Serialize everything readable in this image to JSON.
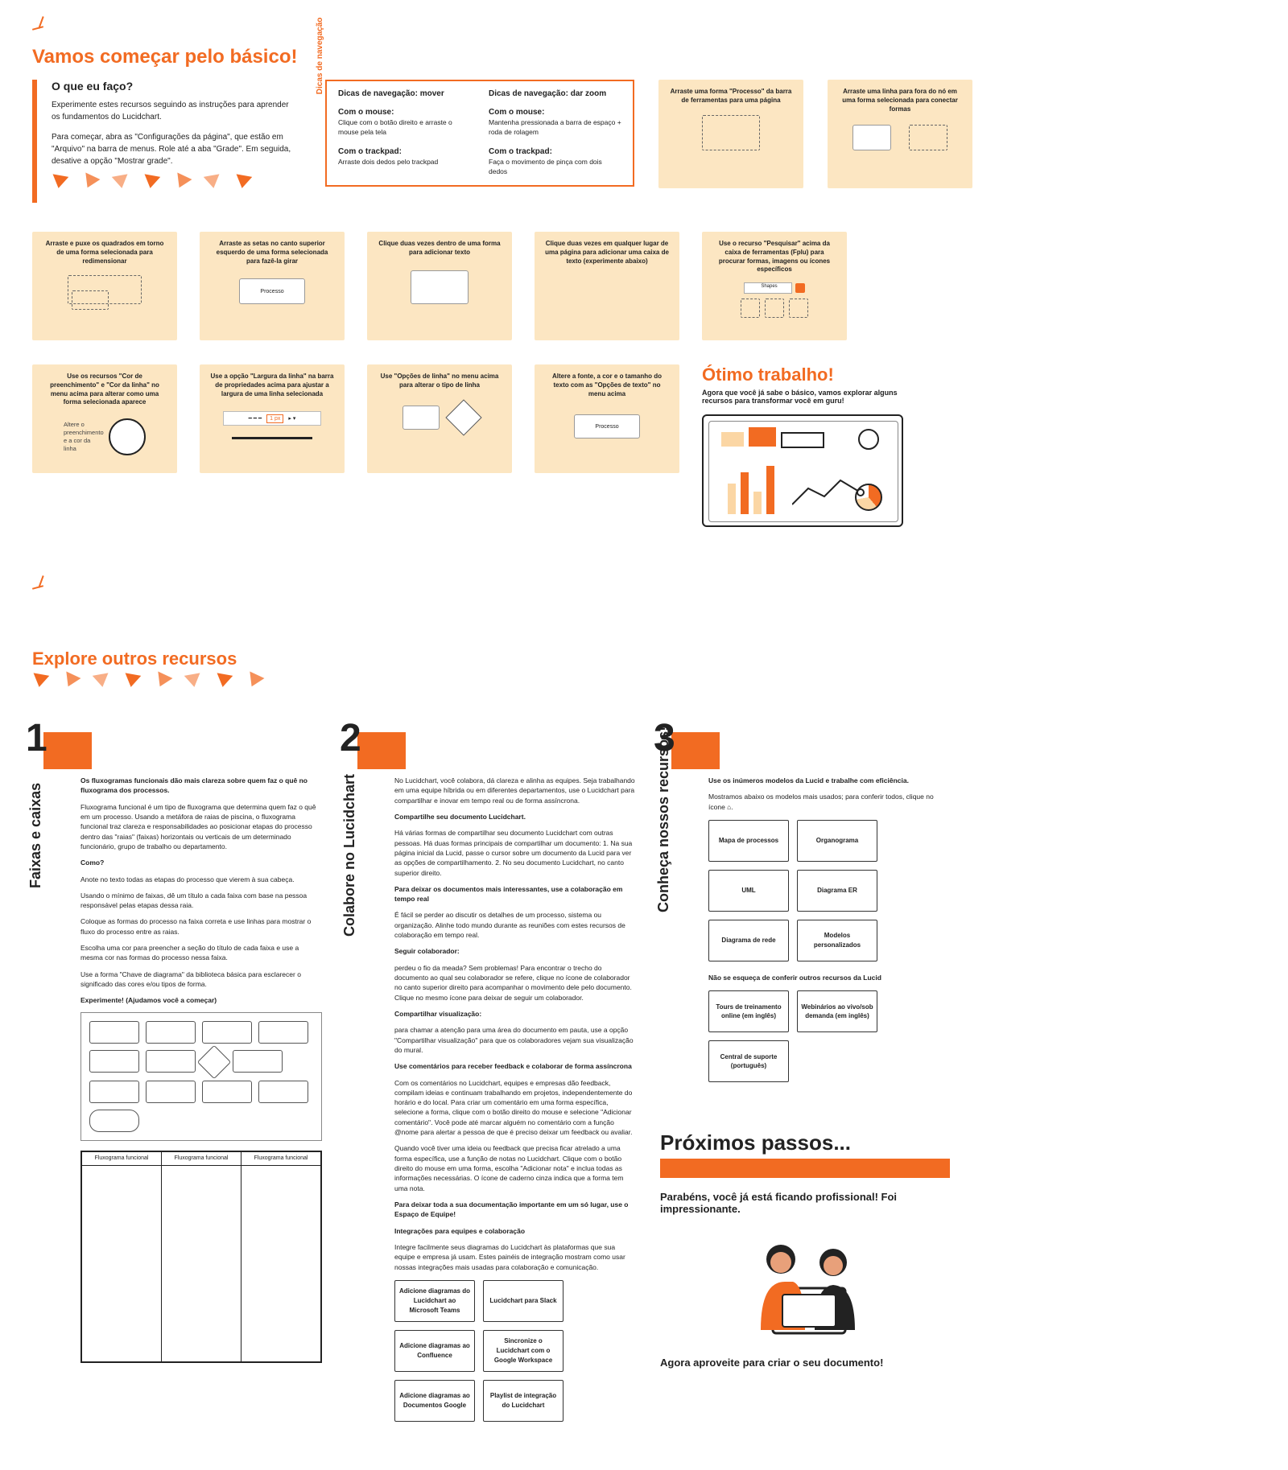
{
  "header": {
    "title": "Vamos começar pelo básico!",
    "q": "O que eu faço?",
    "p1": "Experimente estes recursos seguindo as instruções para aprender os fundamentos do Lucidchart.",
    "p2": "Para começar, abra as \"Configurações da página\", que estão em \"Arquivo\" na barra de menus. Role até a aba \"Grade\". Em seguida, desative a opção \"Mostrar grade\"."
  },
  "nav": {
    "label": "Dicas de navegação",
    "col1": {
      "title": "Dicas de navegação: mover",
      "l1": "Com o mouse:",
      "l1b": "Clique com o botão direito e arraste o mouse pela tela",
      "l2": "Com o trackpad:",
      "l2b": "Arraste dois dedos pelo trackpad"
    },
    "col2": {
      "title": "Dicas de navegação: dar zoom",
      "l1": "Com o mouse:",
      "l1b": "Mantenha pressionada a barra de espaço + roda de rolagem",
      "l2": "Com o trackpad:",
      "l2b": "Faça o movimento de pinça com dois dedos"
    }
  },
  "tips": {
    "t1": "Arraste uma forma \"Processo\" da barra de ferramentas para uma página",
    "t2": "Arraste uma linha para fora do nó em uma forma selecionada para conectar formas",
    "t3": "Arraste e puxe os quadrados em torno de uma forma selecionada para redimensionar",
    "t4": "Arraste as setas no canto superior esquerdo de uma forma selecionada para fazê-la girar",
    "t4b": "Processo",
    "t5": "Clique duas vezes dentro de uma forma para adicionar texto",
    "t6": "Clique duas vezes em qualquer lugar de uma página para adicionar uma caixa de texto (experimente abaixo)",
    "t7": "Use o recurso \"Pesquisar\" acima da caixa de ferramentas (Fplu) para procurar formas, imagens ou ícones específicos",
    "t7b": "Shapes",
    "t8": "Use os recursos \"Cor de preenchimento\" e \"Cor da linha\" no menu acima para alterar como uma forma selecionada aparece",
    "t9": "Use a opção \"Largura da linha\" na barra de propriedades acima para ajustar a largura de uma linha selecionada",
    "t10": "Use \"Opções de linha\" no menu acima para alterar o tipo de linha",
    "t11": "Altere a fonte, a cor e o tamanho do texto com as \"Opções de texto\" no menu acima",
    "t11b": "Processo"
  },
  "goodjob": {
    "title": "Ótimo trabalho!",
    "sub": "Agora que você já sabe o básico, vamos explorar alguns recursos para transformar você em guru!"
  },
  "explore": {
    "title": "Explore outros recursos"
  },
  "col1": {
    "vtitle": "Faixas e caixas",
    "lead": "Os fluxogramas funcionais dão mais clareza sobre quem faz o quê no fluxograma dos processos.",
    "p1": "Fluxograma funcional é um tipo de fluxograma que determina quem faz o quê em um processo. Usando a metáfora de raias de piscina, o fluxograma funcional traz clareza e responsabilidades ao posicionar etapas do processo dentro das \"raias\" (faixas) horizontais ou verticais de um determinado funcionário, grupo de trabalho ou departamento.",
    "h2": "Como?",
    "p2": "Anote no texto todas as etapas do processo que vierem à sua cabeça.",
    "p3": "Usando o mínimo de faixas, dê um título a cada faixa com base na pessoa responsável pelas etapas dessa raia.",
    "p4": "Coloque as formas do processo na faixa correta e use linhas para mostrar o fluxo do processo entre as raias.",
    "p5": "Escolha uma cor para preencher a seção do título de cada faixa e use a mesma cor nas formas do processo nessa faixa.",
    "p6": "Use a forma \"Chave de diagrama\" da biblioteca básica para esclarecer o significado das cores e/ou tipos de forma.",
    "try": "Experimente! (Ajudamos você a começar)",
    "lane": "Fluxograma funcional"
  },
  "col2": {
    "vtitle": "Colabore no Lucidchart",
    "lead": "No Lucidchart, você colabora, dá clareza e alinha as equipes. Seja trabalhando em uma equipe híbrida ou em diferentes departamentos, use o Lucidchart para compartilhar e inovar em tempo real ou de forma assíncrona.",
    "sh": "Compartilhe seu documento Lucidchart.",
    "shp": "Há várias formas de compartilhar seu documento Lucidchart com outras pessoas. Há duas formas principais de compartilhar um documento: 1. Na sua página inicial da Lucid, passe o cursor sobre um documento da Lucid para ver as opções de compartilhamento. 2. No seu documento Lucidchart, no canto superior direito.",
    "rt": "Para deixar os documentos mais interessantes, use a colaboração em tempo real",
    "rtp": "É fácil se perder ao discutir os detalhes de um processo, sistema ou organização. Alinhe todo mundo durante as reuniões com estes recursos de colaboração em tempo real.",
    "fo": "Seguir colaborador:",
    "fop": "perdeu o fio da meada? Sem problemas! Para encontrar o trecho do documento ao qual seu colaborador se refere, clique no ícone de colaborador no canto superior direito para acompanhar o movimento dele pelo documento. Clique no mesmo ícone para deixar de seguir um colaborador.",
    "sv": "Compartilhar visualização:",
    "svp": "para chamar a atenção para uma área do documento em pauta, use a opção \"Compartilhar visualização\" para que os colaboradores vejam sua visualização do mural.",
    "cm": "Use comentários para receber feedback e colaborar de forma assíncrona",
    "cmp": "Com os comentários no Lucidchart, equipes e empresas dão feedback, compilam ideias e continuam trabalhando em projetos, independentemente do horário e do local. Para criar um comentário em uma forma específica, selecione a forma, clique com o botão direito do mouse e selecione \"Adicionar comentário\". Você pode até marcar alguém no comentário com a função @nome para alertar a pessoa de que é preciso deixar um feedback ou avaliar.",
    "np": "Quando você tiver uma ideia ou feedback que precisa ficar atrelado a uma forma específica, use a função de notas no Lucidchart. Clique com o botão direito do mouse em uma forma, escolha \"Adicionar nota\" e inclua todas as informações necessárias. O ícone de caderno cinza indica que a forma tem uma nota.",
    "ts": "Para deixar toda a sua documentação importante em um só lugar, use o Espaço de Equipe!",
    "ig": "Integrações para equipes e colaboração",
    "igp": "Integre facilmente seus diagramas do Lucidchart às plataformas que sua equipe e empresa já usam. Estes painéis de integração mostram como usar nossas integrações mais usadas para colaboração e comunicação.",
    "tiles": [
      "Adicione diagramas do Lucidchart ao Microsoft Teams",
      "Lucidchart para Slack",
      "Adicione diagramas ao Confluence",
      "Sincronize o Lucidchart com o Google Workspace",
      "Adicione diagramas ao Documentos Google",
      "Playlist de integração do Lucidchart"
    ]
  },
  "col3": {
    "vtitle": "Conheça nossos recursos!",
    "lead": "Use os inúmeros modelos da Lucid e trabalhe com eficiência.",
    "sub": "Mostramos abaixo os modelos mais usados; para conferir todos, clique no ícone ⌂.",
    "tiles": [
      "Mapa de processos",
      "Organograma",
      "UML",
      "Diagrama ER",
      "Diagrama de rede",
      "Modelos personalizados"
    ],
    "more": "Não se esqueça de conferir outros recursos da Lucid",
    "tiles2": [
      "Tours de treinamento online (em inglês)",
      "Webinários ao vivo/sob demanda (em inglês)",
      "Central de suporte (português)"
    ]
  },
  "next": {
    "title": "Próximos passos...",
    "p1": "Parabéns, você já está ficando profissional! Foi impressionante.",
    "p2": "Agora aproveite para criar o seu documento!"
  }
}
